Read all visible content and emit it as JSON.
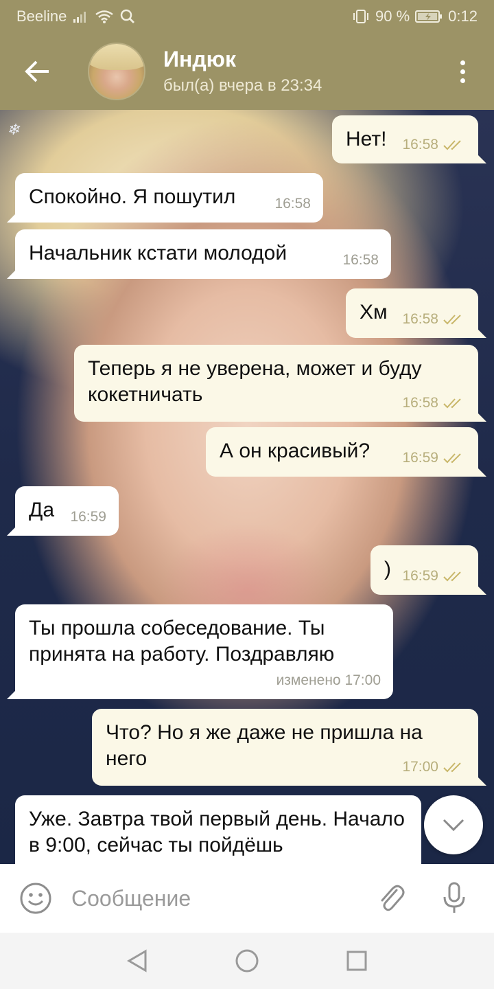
{
  "status_bar": {
    "carrier": "Beeline",
    "battery_percent": "90 %",
    "time": "0:12",
    "icons": [
      "signal-icon",
      "wifi-icon",
      "search-icon",
      "vibrate-icon",
      "battery-icon"
    ]
  },
  "header": {
    "contact_name": "Индюк",
    "contact_status": "был(а) вчера в 23:34",
    "icons": [
      "back-arrow-icon",
      "more-vert-icon"
    ]
  },
  "background": {
    "watermark": "❄"
  },
  "messages": [
    {
      "dir": "out",
      "text": "Нет!",
      "time": "16:58",
      "read": true
    },
    {
      "dir": "in",
      "text": "Спокойно. Я пошутил",
      "time": "16:58"
    },
    {
      "dir": "in",
      "text": "Начальник кстати молодой",
      "time": "16:58"
    },
    {
      "dir": "out",
      "text": "Хм",
      "time": "16:58",
      "read": true
    },
    {
      "dir": "out",
      "text": "Теперь я не уверена, может и буду кокетничать",
      "time": "16:58",
      "read": true
    },
    {
      "dir": "out",
      "text": "А он красивый?",
      "time": "16:59",
      "read": true
    },
    {
      "dir": "in",
      "text": "Да",
      "time": "16:59"
    },
    {
      "dir": "out",
      "text": ")",
      "time": "16:59",
      "read": true
    },
    {
      "dir": "in",
      "text": "Ты прошла собеседование. Ты принята на работу. Поздравляю",
      "time": "изменено 17:00"
    },
    {
      "dir": "out",
      "text": "Что? Но я же даже не пришла на него",
      "time": "17:00",
      "read": true
    },
    {
      "dir": "in",
      "text": "Уже. Завтра твой первый день. Начало в 9:00, сейчас ты пойдёшь",
      "time": ""
    }
  ],
  "input": {
    "placeholder": "Сообщение",
    "value": ""
  },
  "colors": {
    "header_bg": "#9c9366",
    "incoming_bubble": "#ffffff",
    "outgoing_bubble": "#fbf8e7",
    "read_checks": "#c9b76a"
  },
  "nav_bar": {
    "icons": [
      "back-triangle-icon",
      "home-circle-icon",
      "recents-square-icon"
    ]
  }
}
